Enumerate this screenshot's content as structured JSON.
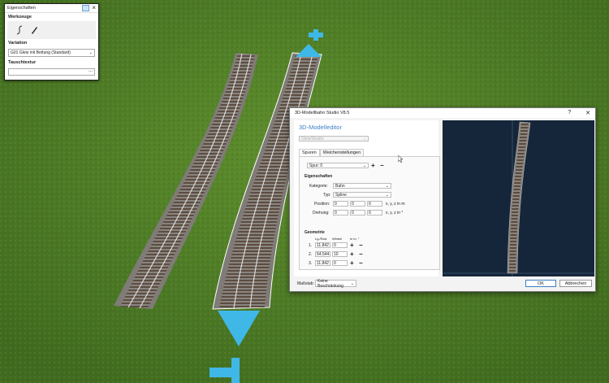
{
  "properties_panel": {
    "title": "Eigenschaften",
    "tools_heading": "Werkzeuge",
    "variation_heading": "Variation",
    "variation_value": "G01 Gleis mit Bettung (Standard)",
    "texture_heading": "Tauschtextur",
    "texture_button": "..."
  },
  "dialog": {
    "title": "3D-Modellbahn Studio V8.5",
    "help": "?",
    "close": "✕",
    "heading": "3D-Modelleditor",
    "type_value": "Gleis/Straße",
    "tabs": [
      "Spuren",
      "Weichenstellungen"
    ],
    "track_select": "Spur: 0",
    "props_heading": "Eigenschaften",
    "category_label": "Kategorie:",
    "category_value": "Bahn",
    "type_label": "Typ:",
    "type_select": "Spline",
    "position_label": "Position:",
    "position_values": [
      "0",
      "0",
      "0"
    ],
    "position_unit": "x, y, z in m",
    "rotation_label": "Drehung:",
    "rotation_values": [
      "0",
      "0",
      "0"
    ],
    "rotation_unit": "x, y, z in °",
    "geometry_heading": "Geometrie",
    "col_length": "Lg./Rad.",
    "col_angle": "Winkel",
    "col_unit": "in m, °",
    "geometry_rows": [
      {
        "index": "1.",
        "length": "11.842",
        "angle": "0"
      },
      {
        "index": "2.",
        "length": "64.544",
        "angle": "10"
      },
      {
        "index": "3.",
        "length": "11.842",
        "angle": "0"
      }
    ],
    "scale_label": "Maßstab:",
    "scale_value": "Keine Beschränkung",
    "ok": "OK",
    "cancel": "Abbrechen"
  },
  "colors": {
    "accent": "#3d7fc4",
    "gizmo": "#3fb8e8",
    "grass": "#4f7d28",
    "preview_bg": "#16263a"
  }
}
